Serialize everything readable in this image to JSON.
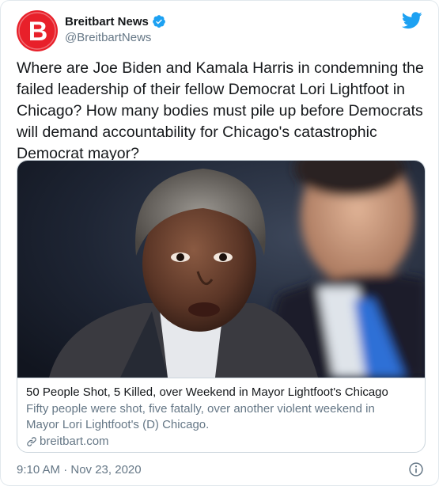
{
  "author": {
    "display_name": "Breitbart News",
    "handle": "@BreitbartNews",
    "avatar_letter": "B",
    "verified": true,
    "brand_color": "#e8202a"
  },
  "tweet": {
    "text": "Where are Joe Biden and Kamala Harris in condemning the\nfailed leadership of their fellow Democrat Lori Lightfoot in\nChicago? How many bodies must pile up before Democrats\nwill demand accountability for Chicago's catastrophic\nDemocrat mayor?"
  },
  "card": {
    "title": "50 People Shot, 5 Killed, over Weekend in Mayor Lightfoot's Chicago",
    "description": "Fifty people were shot, five fatally, over another violent weekend in\nMayor Lori Lightfoot's (D) Chicago.",
    "domain": "breitbart.com"
  },
  "meta": {
    "timestamp": "9:10 AM · Nov 23, 2020"
  },
  "icons": {
    "verified": "verified-badge-icon",
    "twitter": "twitter-bird-icon",
    "link": "link-icon",
    "info": "info-icon"
  },
  "colors": {
    "twitter_blue": "#1da1f2",
    "text_primary": "#14171a",
    "text_secondary": "#657786",
    "border": "#e1e8ed"
  }
}
